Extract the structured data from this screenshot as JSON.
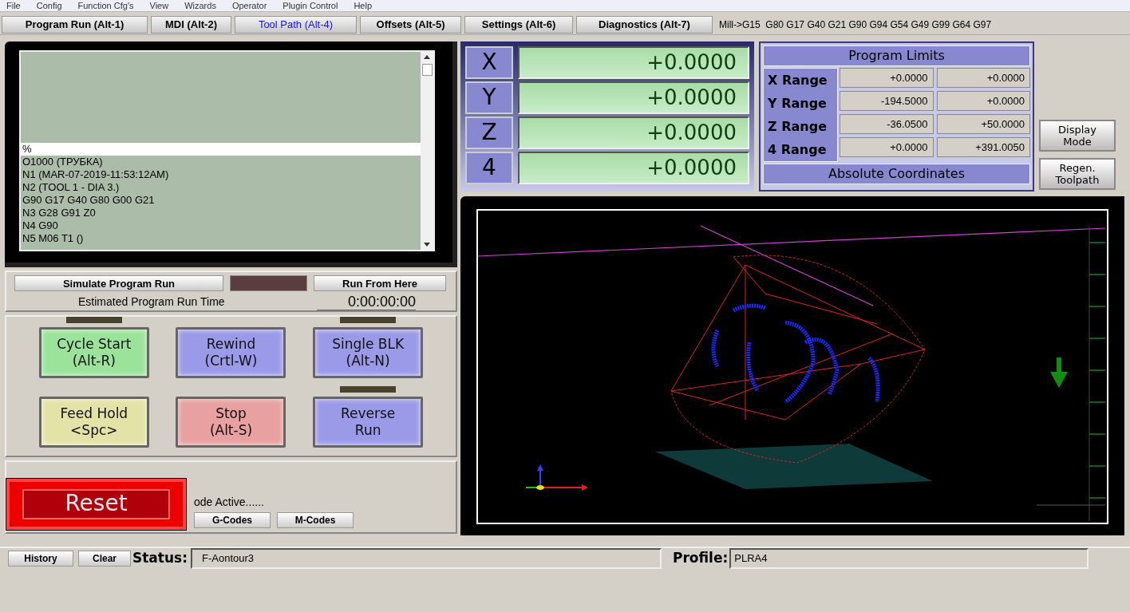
{
  "menu": [
    "File",
    "Config",
    "Function Cfg's",
    "View",
    "Wizards",
    "Operator",
    "Plugin Control",
    "Help"
  ],
  "tabs": [
    {
      "label": "Program Run (Alt-1)",
      "selected": false
    },
    {
      "label": "MDI (Alt-2)",
      "selected": false
    },
    {
      "label": "Tool Path (Alt-4)",
      "selected": true
    },
    {
      "label": "Offsets (Alt-5)",
      "selected": false
    },
    {
      "label": "Settings (Alt-6)",
      "selected": false
    },
    {
      "label": "Diagnostics (Alt-7)",
      "selected": false
    }
  ],
  "modal_codes": "Mill->G15  G80 G17 G40 G21 G90 G94 G54 G49 G99 G64 G97",
  "gcode_listing": {
    "lines": [
      {
        "text": "%",
        "selected": true
      },
      {
        "text": "O1000 (ТРУБКА)",
        "selected": false
      },
      {
        "text": "N1 (MAR-07-2019-11:53:12AM)",
        "selected": false
      },
      {
        "text": "N2 (TOOL 1 - DIA 3.)",
        "selected": false
      },
      {
        "text": "G90 G17 G40 G80 G00 G21",
        "selected": false
      },
      {
        "text": "N3 G28 G91 Z0",
        "selected": false
      },
      {
        "text": "N4 G90",
        "selected": false
      },
      {
        "text": "N5 M06 T1 ()",
        "selected": false
      }
    ]
  },
  "simulate_button": "Simulate Program Run",
  "run_from_here_button": "Run From Here",
  "estimated_run_time": {
    "label": "Estimated Program Run Time",
    "value": "0:00:00:00"
  },
  "cycle_buttons": [
    {
      "label": "Cycle Start",
      "shortcut": "(Alt-R)",
      "color": "#9be39b",
      "led": true
    },
    {
      "label": "Rewind",
      "shortcut": "(Crtl-W)",
      "color": "#9a9ae8",
      "led": false
    },
    {
      "label": "Single BLK",
      "shortcut": "(Alt-N)",
      "color": "#9a9ae8",
      "led": true
    },
    {
      "label": "Feed Hold",
      "shortcut": "<Spc>",
      "color": "#e3e3a8",
      "led": false
    },
    {
      "label": "Stop",
      "shortcut": "(Alt-S)",
      "color": "#e8a0a0",
      "led": false
    },
    {
      "label": "Reverse",
      "shortcut": "Run",
      "color": "#9a9ae8",
      "led": true
    }
  ],
  "reset_button": "Reset",
  "code_active": "ode Active......",
  "code_buttons": [
    "G-Codes",
    "M-Codes"
  ],
  "dro": [
    {
      "axis": "X",
      "value": "+0.0000"
    },
    {
      "axis": "Y",
      "value": "+0.0000"
    },
    {
      "axis": "Z",
      "value": "+0.0000"
    },
    {
      "axis": "4",
      "value": "+0.0000"
    }
  ],
  "program_limits": {
    "title": "Program Limits",
    "rows": [
      {
        "label": "X Range",
        "min": "+0.0000",
        "max": "+0.0000"
      },
      {
        "label": "Y Range",
        "min": "-194.5000",
        "max": "+0.0000"
      },
      {
        "label": "Z Range",
        "min": "-36.0500",
        "max": "+50.0000"
      },
      {
        "label": "4 Range",
        "min": "+0.0000",
        "max": "+391.0050"
      }
    ],
    "mode": "Absolute Coordinates"
  },
  "view_buttons": [
    "Display Mode",
    "Regen. Toolpath"
  ],
  "status_bar": {
    "history_button": "History",
    "clear_button": "Clear",
    "status_label": "Status:",
    "status": "F-Aontour3",
    "profile_label": "Profile:",
    "profile": "PLRA4"
  }
}
